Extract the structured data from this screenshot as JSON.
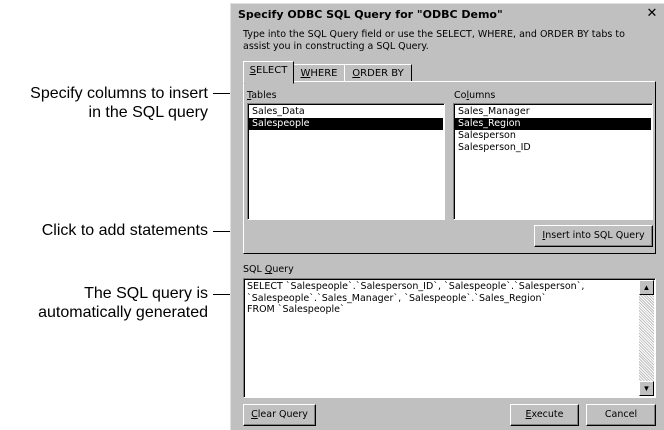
{
  "callouts": {
    "columns": [
      "Specify columns to insert",
      "in the SQL query"
    ],
    "add": [
      "Click to add statements"
    ],
    "generated": [
      "The SQL query is",
      "automatically generated"
    ]
  },
  "dialog": {
    "title": "Specify ODBC SQL Query for \"ODBC Demo\"",
    "close_glyph": "✕",
    "instructions": "Type into the SQL Query field or use the SELECT, WHERE, and ORDER BY tabs to assist you in constructing a SQL Query.",
    "tabs": [
      {
        "label": "SELECT",
        "access": "S",
        "rest": "ELECT",
        "active": true
      },
      {
        "label": "WHERE",
        "access": "W",
        "rest": "HERE",
        "active": false
      },
      {
        "label": "ORDER BY",
        "access": "O",
        "rest": "RDER BY",
        "active": false
      }
    ],
    "tables_label": {
      "access": "T",
      "rest": "ables"
    },
    "tables": [
      {
        "name": "Sales_Data",
        "selected": false
      },
      {
        "name": "Salespeople",
        "selected": true
      }
    ],
    "columns_label": {
      "pre": "Co",
      "access": "l",
      "rest": "umns"
    },
    "columns": [
      {
        "name": "Sales_Manager",
        "selected": false
      },
      {
        "name": "Sales_Region",
        "selected": true
      },
      {
        "name": "Salesperson",
        "selected": false
      },
      {
        "name": "Salesperson_ID",
        "selected": false
      }
    ],
    "insert_button": {
      "access": "I",
      "rest": "nsert into SQL Query"
    },
    "sql_label": {
      "pre": "SQL ",
      "access": "Q",
      "rest": "uery"
    },
    "sql_text": "SELECT `Salespeople`.`Salesperson_ID`, `Salespeople`.`Salesperson`,\n`Salespeople`.`Sales_Manager`, `Salespeople`.`Sales_Region`\nFROM `Salespeople`",
    "clear_button": {
      "access": "C",
      "rest": "lear Query"
    },
    "execute_button": {
      "access": "E",
      "rest": "xecute"
    },
    "cancel_button": "Cancel"
  }
}
